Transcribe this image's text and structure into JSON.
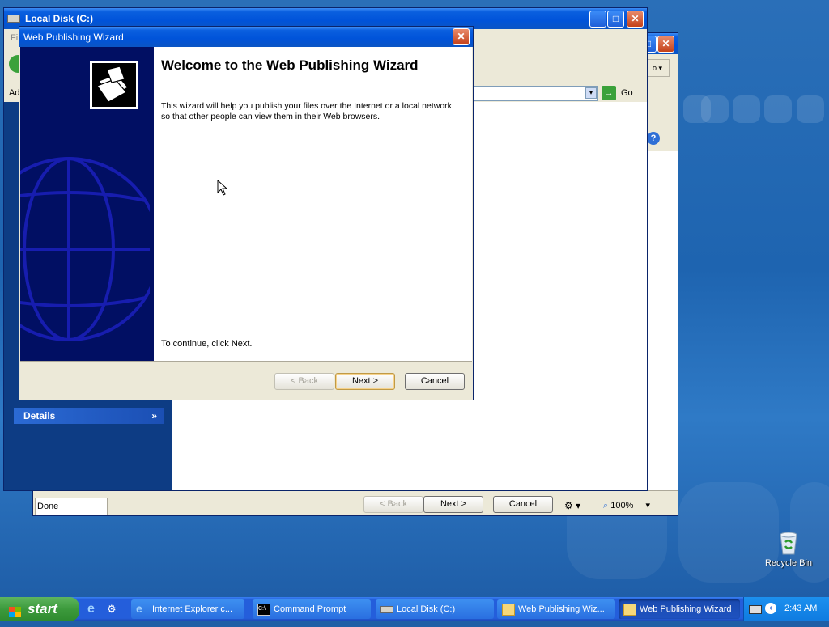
{
  "desktop": {
    "recycle_bin_label": "Recycle Bin"
  },
  "explorer_window": {
    "title": "Local Disk (C:)",
    "address_prefix": "Ad",
    "menu_initial": "Fi",
    "go_label": "Go",
    "details_label": "Details"
  },
  "ie_window": {
    "status_text": "Done",
    "zoom_label": "100%",
    "back_label": "< Back",
    "next_label": "Next >",
    "cancel_label": "Cancel"
  },
  "wizard": {
    "title": "Web Publishing Wizard",
    "heading": "Welcome to the Web Publishing Wizard",
    "description_line1": "This wizard will help you publish your files over the Internet or a local network",
    "description_line2": "so that other people can view them in their Web browsers.",
    "continue_text": "To continue, click Next.",
    "back_label": "< Back",
    "next_label": "Next >",
    "cancel_label": "Cancel"
  },
  "taskbar": {
    "start_label": "start",
    "items": [
      {
        "label": "Internet Explorer c..."
      },
      {
        "label": "Command Prompt"
      },
      {
        "label": "Local Disk (C:)"
      },
      {
        "label": "Web Publishing Wiz..."
      },
      {
        "label": "Web Publishing Wizard"
      }
    ],
    "clock": "2:43 AM"
  },
  "colors": {
    "title_blue": "#0054e3",
    "taskbar_blue": "#245edb",
    "start_green": "#3c9a3c",
    "wizard_banner": "#010f63"
  }
}
